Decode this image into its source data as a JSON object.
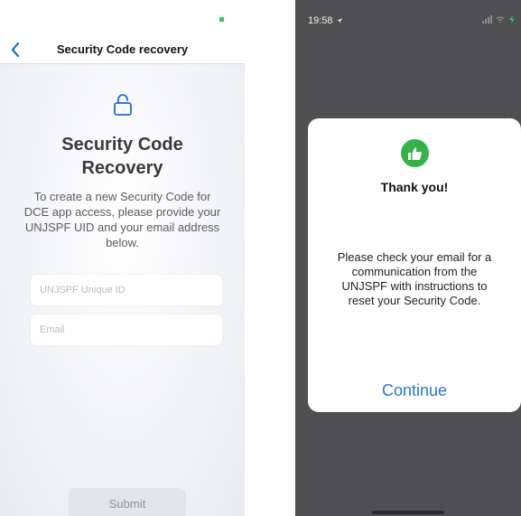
{
  "left_screen": {
    "nav": {
      "title": "Security Code recovery",
      "back_icon": "chevron-left-icon"
    },
    "form": {
      "lock_icon": "unlock-icon",
      "heading": "Security Code\nRecovery",
      "description": "To create a new Security Code for DCE app access, please provide your UNJSPF UID and your email address below.",
      "uid_placeholder": "UNJSPF Unique ID",
      "uid_value": "",
      "email_placeholder": "Email",
      "email_value": "",
      "submit_label": "Submit"
    },
    "colors": {
      "accent": "#1f6fd1",
      "status_green": "#34c759"
    }
  },
  "right_screen": {
    "status_bar": {
      "time": "19:58",
      "location_icon": "location-arrow-icon",
      "signal_icon": "signal-icon",
      "wifi_icon": "wifi-icon",
      "battery_icon": "battery-charging-icon"
    },
    "dialog": {
      "icon": "thumbs-up-icon",
      "title": "Thank you!",
      "message": "Please check your email for a communication from the UNJSPF with instructions to reset your Security Code.",
      "continue_label": "Continue"
    },
    "colors": {
      "icon_green": "#35b24a",
      "link_blue": "#2a78d2",
      "overlay": "#4f4f51"
    }
  }
}
